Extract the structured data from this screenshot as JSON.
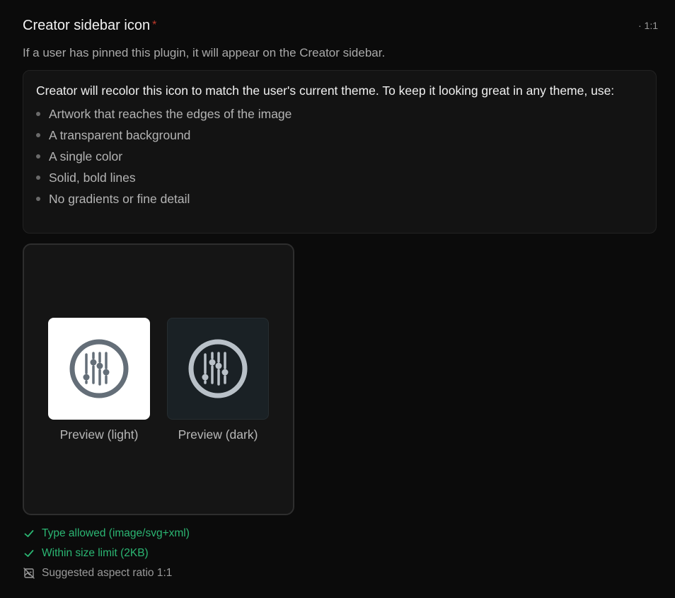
{
  "field": {
    "title": "Creator sidebar icon",
    "required_mark": "*",
    "aspect_hint": "· 1:1",
    "description": "If a user has pinned this plugin, it will appear on the Creator sidebar."
  },
  "guidance": {
    "intro": "Creator will recolor this icon to match the user's current theme. To keep it looking great in any theme, use:",
    "items": [
      "Artwork that reaches the edges of the image",
      "A transparent background",
      "A single color",
      "Solid, bold lines",
      "No gradients or fine detail"
    ]
  },
  "previews": {
    "light_label": "Preview (light)",
    "dark_label": "Preview (dark)",
    "icon_name": "sliders-circle-icon",
    "light_icon_color": "#646e78",
    "dark_icon_color": "#b9c1c8"
  },
  "checks": [
    {
      "status": "ok",
      "icon": "check-icon",
      "text": "Type allowed (image/svg+xml)"
    },
    {
      "status": "ok",
      "icon": "check-icon",
      "text": "Within size limit (2KB)"
    },
    {
      "status": "warn",
      "icon": "aspect-ratio-off-icon",
      "text": "Suggested aspect ratio 1:1"
    }
  ],
  "colors": {
    "success": "#2bb673",
    "required": "#c0392b"
  }
}
